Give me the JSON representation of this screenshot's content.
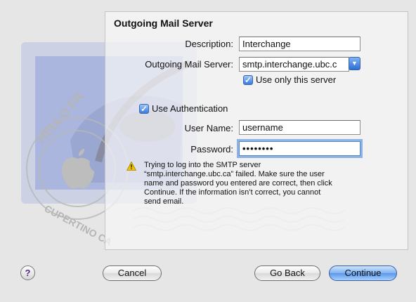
{
  "title": "Outgoing Mail Server",
  "fields": {
    "description": {
      "label": "Description:",
      "value": "Interchange"
    },
    "outgoing_server": {
      "label": "Outgoing Mail Server:",
      "value": "smtp.interchange.ubc.c"
    },
    "user_name": {
      "label": "User Name:",
      "value": "username"
    },
    "password": {
      "label": "Password:",
      "value": "••••••••"
    }
  },
  "checkboxes": {
    "use_only_this_server": {
      "label": "Use only this server",
      "checked": true
    },
    "use_authentication": {
      "label": "Use Authentication",
      "checked": true
    }
  },
  "warning": "Trying to log into the SMTP server “smtp.interchange.ubc.ca” failed. Make sure the user name and password you entered are correct, then click Continue. If the information isn’t correct, you cannot send email.",
  "buttons": {
    "help": "?",
    "cancel": "Cancel",
    "go_back": "Go Back",
    "continue": "Continue"
  },
  "check_glyph": "✓",
  "popup_glyph": "▼",
  "stamp": {
    "text_top": "HELLO FR",
    "text_bottom": "CUPERTINO CA"
  },
  "colors": {
    "accent": "#3a7ae0",
    "warning": "#f2c400"
  }
}
